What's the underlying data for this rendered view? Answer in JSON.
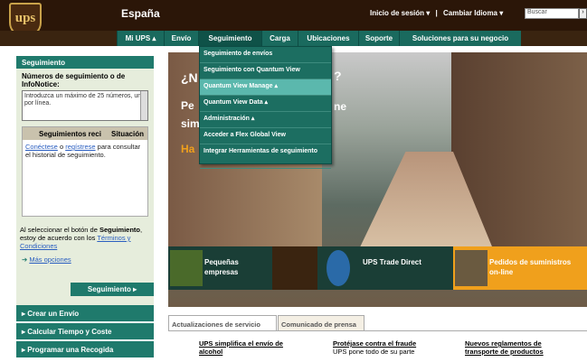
{
  "header": {
    "logo": "ups",
    "country": "España",
    "login": "Inicio de sesión ▾",
    "separator": "|",
    "language": "Cambiar Idioma ▾",
    "search_placeholder": "Buscar"
  },
  "nav": {
    "items": [
      "Mi UPS ▴",
      "Envío",
      "Seguimiento",
      "Carga",
      "Ubicaciones",
      "Soporte",
      "Soluciones para su negocio"
    ]
  },
  "dropdown": {
    "items": [
      "Seguimiento de envíos",
      "Seguimiento con Quantum View",
      "Quantum View Manage ▴",
      "Quantum View Data ▴",
      "Administración ▴",
      "Acceder a Flex Global View",
      "Integrar Herramientas de seguimiento"
    ]
  },
  "left": {
    "header": "Seguimiento",
    "label": "Números de seguimiento o de InfoNotice:",
    "textarea": "Introduzca un máximo de 25 números, uno por línea.",
    "col1": "Seguimientos reci",
    "col2": "Situación",
    "login_text_1": "Conéctese",
    "login_text_2": " o ",
    "login_text_3": "regístrese",
    "login_text_4": " para consultar el historial de seguimiento.",
    "note_1": "Al seleccionar el botón de ",
    "note_bold": "Seguimiento",
    "note_2": ", estoy de acuerdo con los ",
    "note_link": "Términos y Condiciones",
    "more": "Más opciones",
    "button": "Seguimiento ▸",
    "bottom": [
      "▸  Crear un Envío",
      "▸  Calcular Tiempo y Coste",
      "▸  Programar una Recogida"
    ]
  },
  "hero": {
    "t1": "¿N",
    "t2": "Pe",
    "t3": "sim",
    "t4": "Ha",
    "t5": "?",
    "t6": "ne"
  },
  "strip": {
    "c1": "Pequeñas empresas",
    "c2": "UPS Trade Direct",
    "c3": "Pedidos de suministros on-line"
  },
  "tabs": [
    "Actualizaciones de servicio",
    "Comunicado de prensa"
  ],
  "news": [
    {
      "title": "UPS simplifica el envío de alcohol",
      "body": ""
    },
    {
      "title": "Protéjase contra el fraude",
      "body": "UPS pone todo de su parte"
    },
    {
      "title": "Nuevos reglamentos de transporte de productos",
      "body": ""
    }
  ]
}
